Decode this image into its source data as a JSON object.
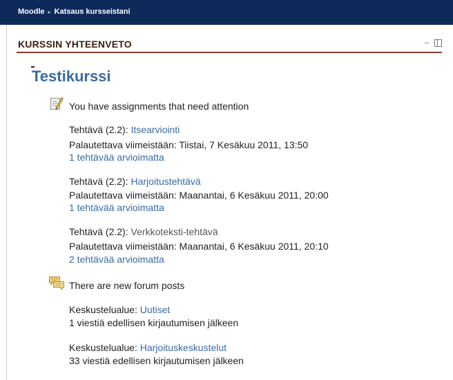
{
  "breadcrumb": {
    "home": "Moodle",
    "separator": "▸",
    "current": "Katsaus kursseistani"
  },
  "block": {
    "title": "KURSSIN YHTEENVETO",
    "hide_symbol": "–"
  },
  "course": {
    "name": "Testikurssi"
  },
  "assignments_section": {
    "icon": "assignment-icon",
    "heading": "You have assignments that need attention",
    "items": [
      {
        "prefix": "Tehtävä (2.2): ",
        "name": "Itsearviointi",
        "due": "Palautettava viimeistään: Tiistai, 7 Kesäkuu 2011, 13:50",
        "status": "1 tehtävää arvioimatta"
      },
      {
        "prefix": "Tehtävä (2.2): ",
        "name": "Harjoitustehtävä",
        "due": "Palautettava viimeistään: Maanantai, 6 Kesäkuu 2011, 20:00",
        "status": "1 tehtävää arvioimatta"
      },
      {
        "prefix": "Tehtävä (2.2): ",
        "name": "Verkkoteksti-tehtävä",
        "due": "Palautettava viimeistään: Maanantai, 6 Kesäkuu 2011, 20:10",
        "status": "2 tehtävää arvioimatta"
      }
    ]
  },
  "forum_section": {
    "icon": "forum-icon",
    "heading": "There are new forum posts",
    "items": [
      {
        "prefix": "Keskustelualue: ",
        "name": "Uutiset",
        "posts": "1 viestiä edellisen kirjautumisen jälkeen"
      },
      {
        "prefix": "Keskustelualue: ",
        "name": "Harjoituskeskustelut",
        "posts": "33 viestiä edellisen kirjautumisen jälkeen"
      }
    ]
  },
  "colors": {
    "navbar": "#0e2a5a",
    "link": "#3a6aa0",
    "block_rule": "#8c3a2c"
  }
}
